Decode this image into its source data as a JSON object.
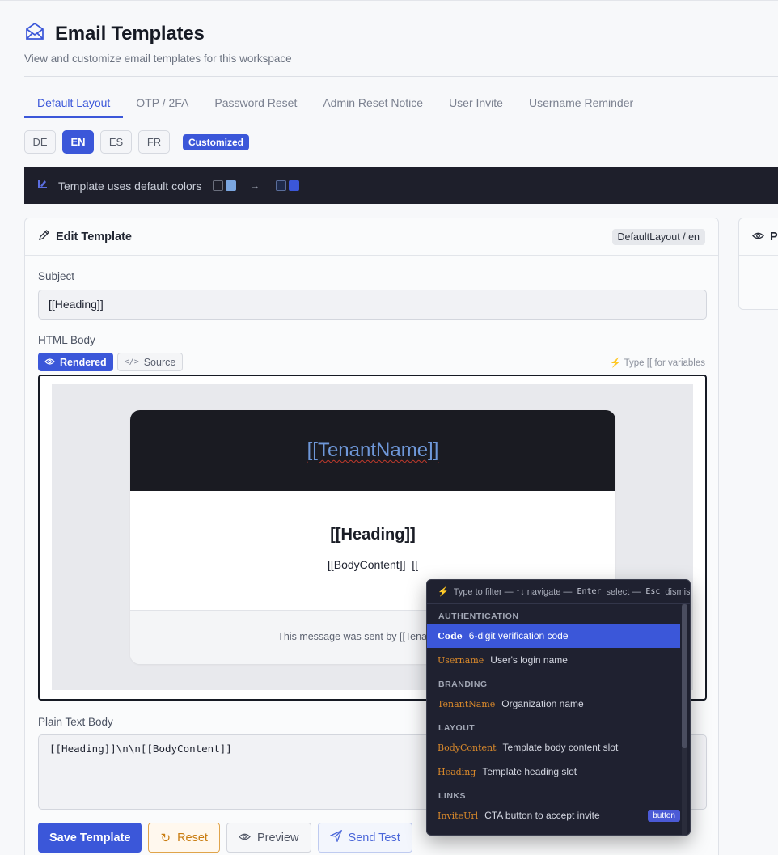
{
  "header": {
    "title": "Email Templates",
    "subtitle": "View and customize email templates for this workspace"
  },
  "tabs": [
    {
      "label": "Default Layout",
      "active": true
    },
    {
      "label": "OTP / 2FA",
      "active": false
    },
    {
      "label": "Password Reset",
      "active": false
    },
    {
      "label": "Admin Reset Notice",
      "active": false
    },
    {
      "label": "User Invite",
      "active": false
    },
    {
      "label": "Username Reminder",
      "active": false
    }
  ],
  "languages": [
    {
      "code": "DE",
      "active": false
    },
    {
      "code": "EN",
      "active": true
    },
    {
      "code": "ES",
      "active": false
    },
    {
      "code": "FR",
      "active": false
    }
  ],
  "customized_badge": "Customized",
  "color_notice": {
    "text": "Template uses default colors",
    "arrow": "→",
    "from_colors": [
      "#1e1f2b",
      "#7ba6e0"
    ],
    "to_colors": [
      "#1e2a4a",
      "#3b57d9"
    ]
  },
  "edit_card": {
    "title": "Edit Template",
    "path_badge": "DefaultLayout / en",
    "subject_label": "Subject",
    "subject_value": "[[Heading]]",
    "html_body_label": "HTML Body",
    "mode_rendered": "Rendered",
    "mode_source": "Source",
    "hint": "Type [[ for variables",
    "email_preview": {
      "header_text": "[[TenantName]]",
      "heading": "[[Heading]]",
      "body": "[[BodyContent]]  [[",
      "footer": "This message was sent by [[TenantName]]"
    },
    "plain_label": "Plain Text Body",
    "plain_value": "[[Heading]]\\n\\n[[BodyContent]]"
  },
  "actions": {
    "save": "Save Template",
    "reset": "Reset",
    "preview": "Preview",
    "send_test": "Send Test"
  },
  "preview_card": {
    "title": "Pr"
  },
  "autocomplete": {
    "hint_text": "Type to filter — ↑↓ navigate —",
    "enter_key": "Enter",
    "select_text": "select —",
    "esc_key": "Esc",
    "dismiss_text": "dismiss",
    "groups": [
      {
        "label": "AUTHENTICATION",
        "items": [
          {
            "key": "Code",
            "desc": "6-digit verification code",
            "selected": true
          },
          {
            "key": "Username",
            "desc": "User's login name",
            "selected": false
          }
        ]
      },
      {
        "label": "BRANDING",
        "items": [
          {
            "key": "TenantName",
            "desc": "Organization name",
            "selected": false
          }
        ]
      },
      {
        "label": "LAYOUT",
        "items": [
          {
            "key": "BodyContent",
            "desc": "Template body content slot",
            "selected": false
          },
          {
            "key": "Heading",
            "desc": "Template heading slot",
            "selected": false
          }
        ]
      },
      {
        "label": "LINKS",
        "items": [
          {
            "key": "InviteUrl",
            "desc": "CTA button to accept invite",
            "selected": false,
            "tag": "button"
          }
        ]
      }
    ]
  },
  "colors": {
    "accent": "#3b57d9",
    "dark_bar": "#1e1f2b",
    "popup_bg": "#1f2130",
    "reset_orange": "#c97d12"
  }
}
